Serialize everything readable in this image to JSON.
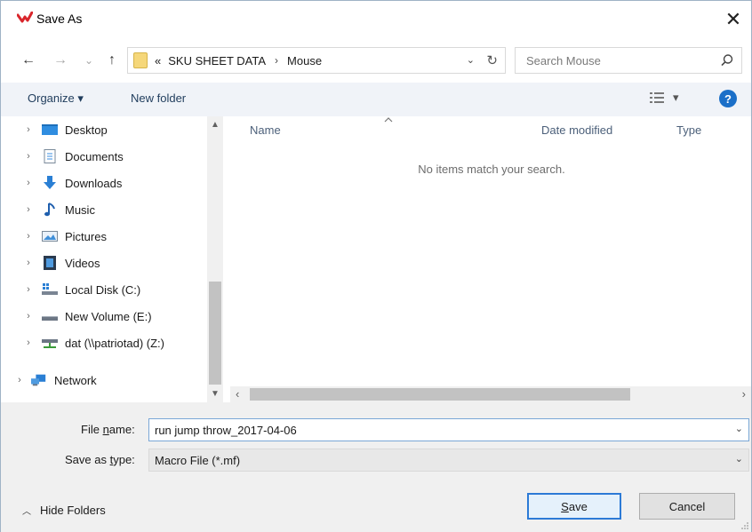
{
  "window": {
    "title": "Save As",
    "close_glyph": "✕"
  },
  "address": {
    "back_glyph": "←",
    "forward_glyph": "→",
    "recent_glyph": "⌄",
    "up_glyph": "↑",
    "overflow": "«",
    "crumbs": [
      "SKU SHEET DATA",
      "Mouse"
    ],
    "separator": "›",
    "dropdown_glyph": "⌄",
    "refresh_glyph": "↻",
    "search_placeholder": "Search Mouse"
  },
  "commandbar": {
    "organize_label": "Organize ▾",
    "new_folder_label": "New folder",
    "view_dropdown_glyph": "▾",
    "help_glyph": "?"
  },
  "navpane": {
    "items": [
      {
        "label": "Desktop",
        "icon": "desktop-icon"
      },
      {
        "label": "Documents",
        "icon": "documents-icon"
      },
      {
        "label": "Downloads",
        "icon": "downloads-icon"
      },
      {
        "label": "Music",
        "icon": "music-icon"
      },
      {
        "label": "Pictures",
        "icon": "pictures-icon"
      },
      {
        "label": "Videos",
        "icon": "videos-icon"
      },
      {
        "label": "Local Disk (C:)",
        "icon": "local-disk-icon"
      },
      {
        "label": "New Volume (E:)",
        "icon": "drive-icon"
      },
      {
        "label": "dat (\\\\patriotad) (Z:)",
        "icon": "network-drive-icon"
      },
      {
        "label": "Network",
        "icon": "network-icon"
      }
    ],
    "chevron": "›"
  },
  "filelist": {
    "columns": [
      "Name",
      "Date modified",
      "Type"
    ],
    "empty_message": "No items match your search."
  },
  "bottom": {
    "filename_label_pre": "File ",
    "filename_label_u": "n",
    "filename_label_post": "ame:",
    "filename_value": "run jump throw_2017-04-06",
    "type_label_pre": "Save as ",
    "type_label_u": "t",
    "type_label_post": "ype:",
    "type_value": "Macro File (*.mf)",
    "hide_folders_label": "Hide Folders",
    "save_label_u": "S",
    "save_label_rest": "ave",
    "cancel_label": "Cancel"
  },
  "colors": {
    "accent": "#2c7ad6",
    "help": "#1b6fc8",
    "link": "#1f3c5c",
    "app_icon": "#d9262c"
  }
}
